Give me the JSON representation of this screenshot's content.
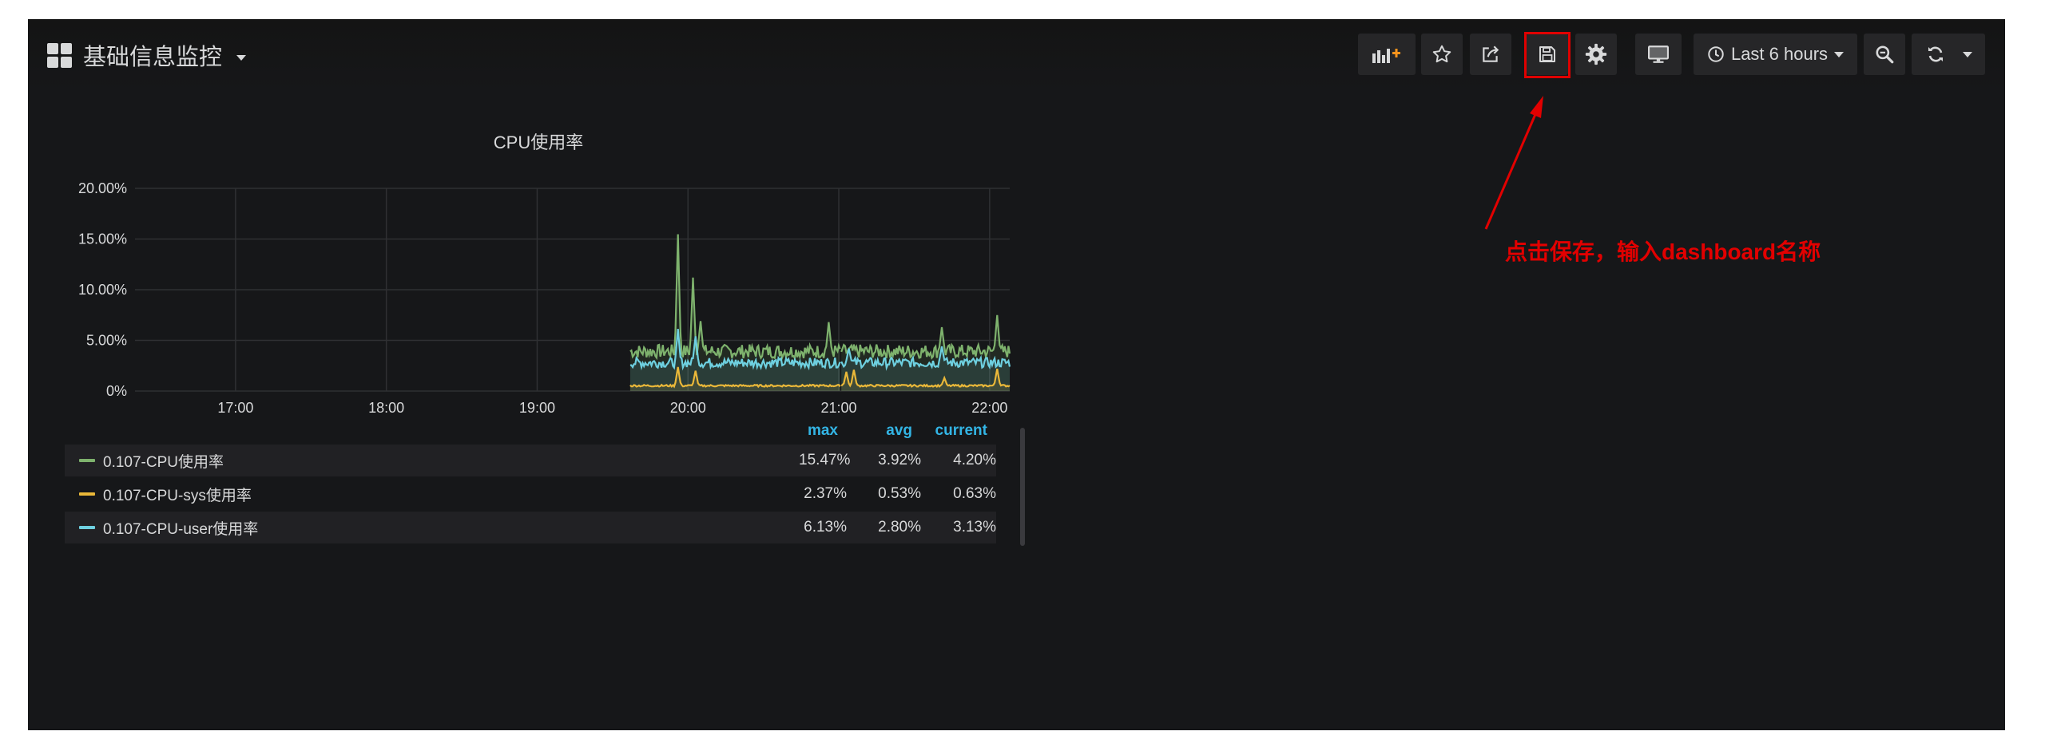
{
  "dashboard": {
    "title": "基础信息监控",
    "icon": "grid-icon"
  },
  "toolbar": {
    "add_panel": "add-panel-icon",
    "star": "star-icon",
    "share": "share-icon",
    "save": "save-icon",
    "settings": "gear-icon",
    "tv_mode": "monitor-icon",
    "time_range": "Last 6 hours",
    "zoom_out": "zoom-out-icon",
    "refresh": "refresh-icon"
  },
  "panel": {
    "title": "CPU使用率"
  },
  "chart_data": {
    "type": "line",
    "title": "CPU使用率",
    "yticks": [
      "0%",
      "5.00%",
      "10.00%",
      "15.00%",
      "20.00%"
    ],
    "ylim": [
      0,
      20
    ],
    "xticks": [
      "17:00",
      "18:00",
      "19:00",
      "20:00",
      "21:00",
      "22:00"
    ],
    "x_range": [
      "16:20",
      "22:08"
    ],
    "data_start": "19:37",
    "grid": true,
    "legend_placement": "bottom-table",
    "series": [
      {
        "name": "0.107-CPU使用率",
        "color": "#7eb26d",
        "baseline": 3.92,
        "spikes": [
          [
            "19:56",
            15.47
          ],
          [
            "20:02",
            11.2
          ],
          [
            "20:05",
            6.9
          ],
          [
            "20:56",
            6.8
          ],
          [
            "21:41",
            6.3
          ],
          [
            "22:03",
            7.5
          ]
        ]
      },
      {
        "name": "0.107-CPU-sys使用率",
        "color": "#eab839",
        "baseline": 0.53,
        "spikes": [
          [
            "19:56",
            2.37
          ],
          [
            "20:03",
            2.0
          ],
          [
            "21:03",
            1.9
          ],
          [
            "21:06",
            2.1
          ],
          [
            "21:42",
            1.3
          ],
          [
            "22:03",
            2.2
          ]
        ]
      },
      {
        "name": "0.107-CPU-user使用率",
        "color": "#6ed0e0",
        "baseline": 2.8,
        "spikes": [
          [
            "19:56",
            6.13
          ],
          [
            "20:03",
            5.4
          ],
          [
            "21:04",
            4.2
          ],
          [
            "21:41",
            4.4
          ]
        ]
      }
    ]
  },
  "legend": {
    "headers": [
      "max",
      "avg",
      "current"
    ],
    "rows": [
      {
        "name": "0.107-CPU使用率",
        "color": "#7eb26d",
        "max": "15.47%",
        "avg": "3.92%",
        "current": "4.20%"
      },
      {
        "name": "0.107-CPU-sys使用率",
        "color": "#eab839",
        "max": "2.37%",
        "avg": "0.53%",
        "current": "0.63%"
      },
      {
        "name": "0.107-CPU-user使用率",
        "color": "#6ed0e0",
        "max": "6.13%",
        "avg": "2.80%",
        "current": "3.13%"
      }
    ]
  },
  "annotation": {
    "text": "点击保存，输入dashboard名称",
    "color": "#e20000"
  }
}
